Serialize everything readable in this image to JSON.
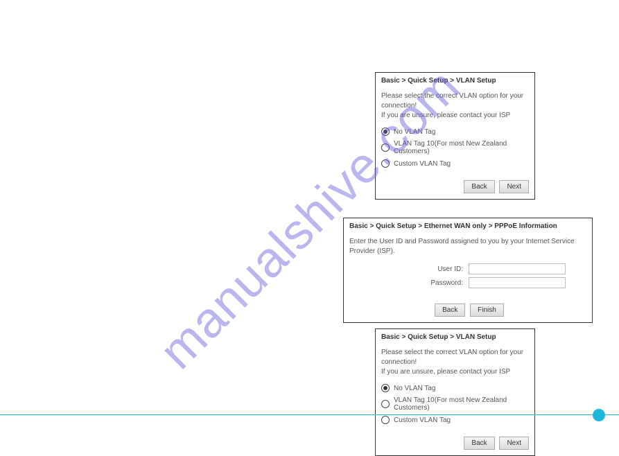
{
  "watermark": "manualshive.com",
  "vlan_panel": {
    "breadcrumb": "Basic > Quick Setup > VLAN Setup",
    "instruction_line1": "Please select the correct VLAN option for your connection!",
    "instruction_line2": "If you are unsure, please contact your ISP",
    "option_no_vlan": "No VLAN Tag",
    "option_vlan10": "VLAN Tag 10(For most New Zealand Customers)",
    "option_custom": "Custom VLAN Tag",
    "back": "Back",
    "next": "Next"
  },
  "pppoe_panel": {
    "breadcrumb": "Basic > Quick Setup > Ethernet WAN only > PPPoE Information",
    "instruction": "Enter the User ID and Password assigned to you by your Internet Service Provider (ISP).",
    "userid_label": "User ID:",
    "password_label": "Password:",
    "userid_value": "",
    "password_value": "",
    "back": "Back",
    "finish": "Finish"
  }
}
